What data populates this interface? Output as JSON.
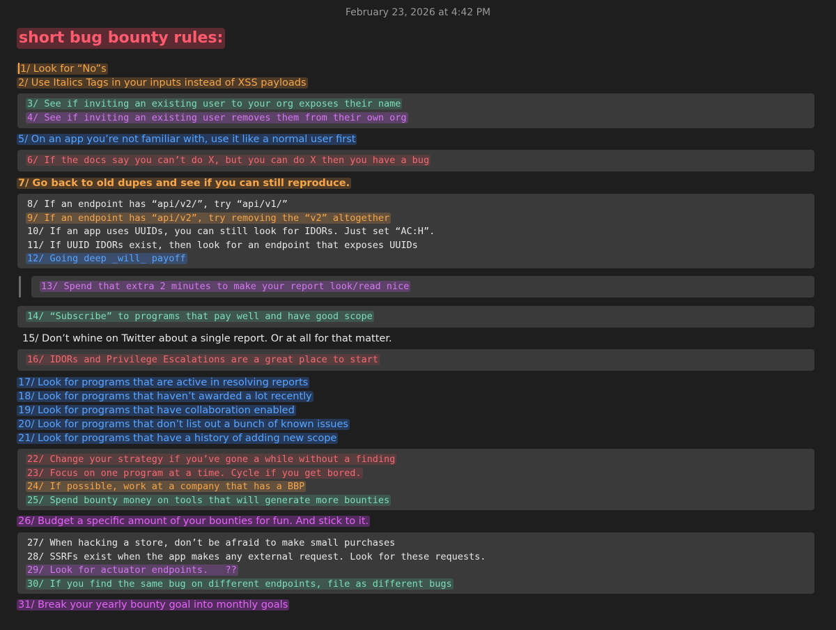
{
  "note": {
    "timestamp": "February 23, 2026 at 4:42 PM",
    "title": "short bug bounty rules:"
  },
  "lines": {
    "l1": "1/ Look for “No”s",
    "l2": "2/ Use Italics Tags in your inputs instead of XSS payloads",
    "l3": "3/ See if inviting an existing user to your org exposes their name",
    "l4": "4/ See if inviting an existing user removes them from their own org",
    "l5": "5/ On an app you’re not familiar with, use it like a normal user first",
    "l6": "6/ If the docs say you can’t do X, but you can do X then you have a bug",
    "l7": "7/ Go back to old dupes and see if you can still reproduce.",
    "l8": "8/ If an endpoint has “api/v2/”, try “api/v1/”",
    "l9": "9/ If an endpoint has “api/v2”, try removing the “v2” altogether",
    "l10": "10/ If an app uses UUIDs, you can still look for IDORs. Just set “AC:H”.",
    "l11": "11/ If UUID IDORs exist, then look for an endpoint that exposes UUIDs",
    "l12": "12/ Going deep _will_ payoff",
    "l13": "13/ Spend that extra 2 minutes to make your report look/read nice",
    "l14": "14/ “Subscribe” to programs that pay well and have good scope",
    "l15": "15/ Don’t whine on Twitter about a single report. Or at all for that matter.",
    "l16": "16/ IDORs and Privilege Escalations are a great place to start",
    "l17": "17/ Look for programs that are active in resolving reports",
    "l18": "18/ Look for programs that haven’t awarded a lot recently",
    "l19": "19/ Look for programs that have collaboration enabled",
    "l20": "20/ Look for programs that don’t list out a bunch of known issues",
    "l21": "21/ Look for programs that have a history of adding new scope",
    "l22": "22/ Change your strategy if you’ve gone a while without a finding",
    "l23": "23/ Focus on one program at a time. Cycle if you get bored.",
    "l24": "24/ If possible, work at a company that has a BBP",
    "l25": "25/ Spend bounty money on tools that will generate more bounties",
    "l26": "26/ Budget a specific amount of your bounties for fun. And stick to it.",
    "l27": "27/ When hacking a store, don’t be afraid to make small purchases",
    "l28": "28/ SSRFs exist when the app makes any external request. Look for these requests.",
    "l29": "29/ Look for actuator endpoints.   ??",
    "l30": "30/ If you find the same bug on different endpoints, file as different bugs",
    "l31": "31/ Break your yearly bounty goal into monthly goals"
  },
  "colors": {
    "background": "#1e1e1e",
    "code_block": "#3a3a3a",
    "title": "#ff5a6e",
    "orange": "#f5a54a",
    "green": "#7fdcb8",
    "purple": "#d478f0",
    "blue": "#58a4ff",
    "red": "#f06b73",
    "magenta": "#e265f5"
  }
}
